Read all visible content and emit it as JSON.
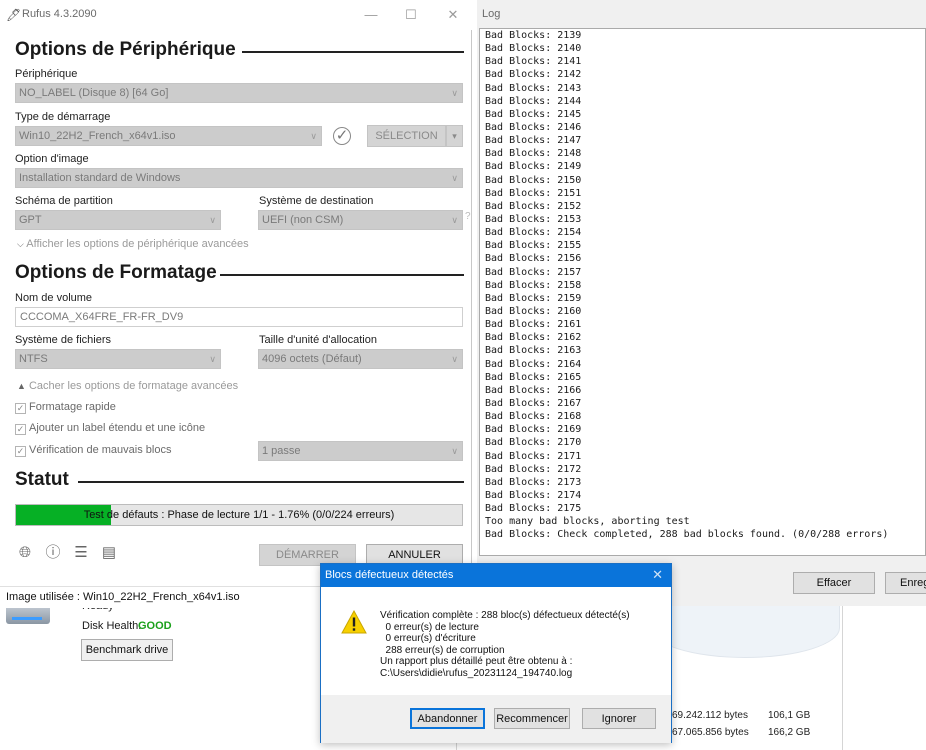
{
  "background_app": {
    "ready_text": "Ready",
    "health_label": "Disk Health:",
    "health_value": "GOOD",
    "benchmark_button": "Benchmark drive",
    "rows": [
      {
        "bytes": "69.242.112 bytes",
        "size": "106,1 GB"
      },
      {
        "bytes": "67.065.856 bytes",
        "size": "166,2 GB"
      }
    ]
  },
  "rufus": {
    "title": "Rufus 4.3.2090",
    "device_section": "Options de Périphérique",
    "device_label": "Périphérique",
    "device_value": "NO_LABEL (Disque 8) [64 Go]",
    "boot_label": "Type de démarrage",
    "boot_value": "Win10_22H2_French_x64v1.iso",
    "select_button": "SÉLECTION",
    "image_option_label": "Option d'image",
    "image_option_value": "Installation standard de Windows",
    "partition_label": "Schéma de partition",
    "partition_value": "GPT",
    "target_label": "Système de destination",
    "target_value": "UEFI (non CSM)",
    "target_help": "?",
    "advanced_device_toggle": "Afficher les options de périphérique avancées",
    "format_section": "Options de Formatage",
    "volume_label": "Nom de volume",
    "volume_value": "CCCOMA_X64FRE_FR-FR_DV9",
    "fs_label": "Système de fichiers",
    "fs_value": "NTFS",
    "cluster_label": "Taille d'unité d'allocation",
    "cluster_value": "4096 octets (Défaut)",
    "advanced_format_toggle": "Cacher les options de formatage avancées",
    "quick_format": "Formatage rapide",
    "extended_label": "Ajouter un label étendu et une icône",
    "bad_blocks": "Vérification de mauvais blocs",
    "passes_value": "1 passe",
    "status_section": "Statut",
    "progress_text": "Test de défauts : Phase de lecture 1/1 - 1.76% (0/0/224 erreurs)",
    "progress_fraction": 0.213,
    "start_button": "DÉMARRER",
    "cancel_button": "ANNULER",
    "status_text": "Image utilisée : Win10_22H2_French_x64v1.iso"
  },
  "log": {
    "title": "Log",
    "lines": [
      "Bad Blocks: 2139",
      "Bad Blocks: 2140",
      "Bad Blocks: 2141",
      "Bad Blocks: 2142",
      "Bad Blocks: 2143",
      "Bad Blocks: 2144",
      "Bad Blocks: 2145",
      "Bad Blocks: 2146",
      "Bad Blocks: 2147",
      "Bad Blocks: 2148",
      "Bad Blocks: 2149",
      "Bad Blocks: 2150",
      "Bad Blocks: 2151",
      "Bad Blocks: 2152",
      "Bad Blocks: 2153",
      "Bad Blocks: 2154",
      "Bad Blocks: 2155",
      "Bad Blocks: 2156",
      "Bad Blocks: 2157",
      "Bad Blocks: 2158",
      "Bad Blocks: 2159",
      "Bad Blocks: 2160",
      "Bad Blocks: 2161",
      "Bad Blocks: 2162",
      "Bad Blocks: 2163",
      "Bad Blocks: 2164",
      "Bad Blocks: 2165",
      "Bad Blocks: 2166",
      "Bad Blocks: 2167",
      "Bad Blocks: 2168",
      "Bad Blocks: 2169",
      "Bad Blocks: 2170",
      "Bad Blocks: 2171",
      "Bad Blocks: 2172",
      "Bad Blocks: 2173",
      "Bad Blocks: 2174",
      "Bad Blocks: 2175",
      "Too many bad blocks, aborting test",
      "Bad Blocks: Check completed, 288 bad blocks found. (0/0/288 errors)"
    ],
    "clear_button": "Effacer",
    "save_button": "Enregistrer"
  },
  "dialog": {
    "title": "Blocs défectueux détectés",
    "message": "Vérification complète : 288 bloc(s) défectueux détecté(s)\n  0 erreur(s) de lecture\n  0 erreur(s) d'écriture\n  288 erreur(s) de corruption\nUn rapport plus détaillé peut être obtenu à :\nC:\\Users\\didie\\rufus_20231124_194740.log",
    "abort_button": "Abandonner",
    "retry_button": "Recommencer",
    "ignore_button": "Ignorer"
  },
  "colors": {
    "progress_green": "#06b025",
    "dialog_titlebar": "#0a74da",
    "health_good": "#1aa01a"
  }
}
